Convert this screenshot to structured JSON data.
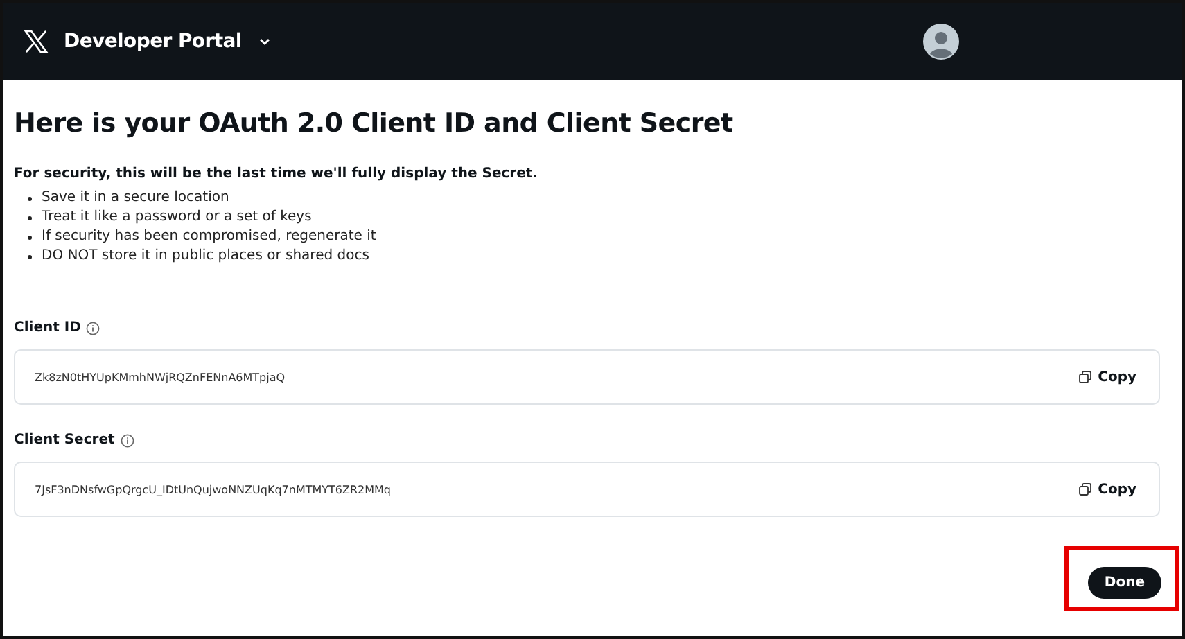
{
  "header": {
    "title": "Developer Portal"
  },
  "heading": "Here is your OAuth 2.0 Client ID and Client Secret",
  "intro": "For security, this will be the last time we'll fully display the Secret.",
  "tips": [
    "Save it in a secure location",
    "Treat it like a password or a set of keys",
    "If security has been compromised, regenerate it",
    "DO NOT store it in public places or shared docs"
  ],
  "credentials": [
    {
      "label": "Client ID",
      "value": "Zk8zN0tHYUpKMmhNWjRQZnFENnA6MTpjaQ",
      "button": "Copy"
    },
    {
      "label": "Client Secret",
      "value": "7JsF3nDNsfwGpQrgcU_IDtUnQujwoNNZUqKq7nMTMYT6ZR2MMq",
      "button": "Copy"
    }
  ],
  "done_button": {
    "label": "Done",
    "highlighted": true
  }
}
